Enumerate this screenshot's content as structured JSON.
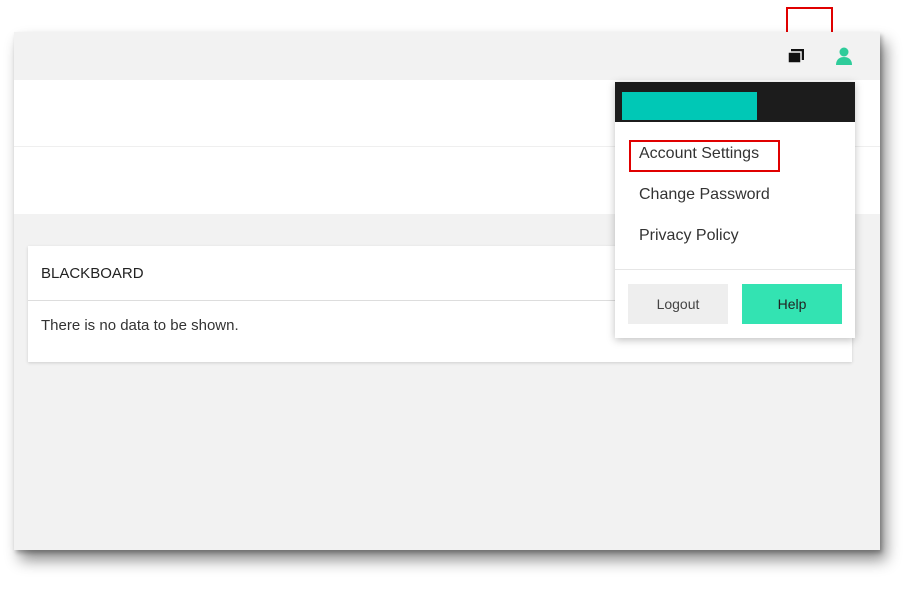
{
  "header": {
    "icons": [
      "windows-icon",
      "user-icon"
    ],
    "user_icon_color": "#2ecc9a"
  },
  "card": {
    "title": "BLACKBOARD",
    "empty_message": "There is no data to be shown."
  },
  "user_menu": {
    "header_color": "#1c1c1c",
    "name_block_color": "#00c8b6",
    "items": [
      {
        "label": "Account Settings"
      },
      {
        "label": "Change Password"
      },
      {
        "label": "Privacy Policy"
      }
    ],
    "logout_label": "Logout",
    "help_label": "Help",
    "help_color": "#33e3b2"
  },
  "annotation_color": "#e00000"
}
